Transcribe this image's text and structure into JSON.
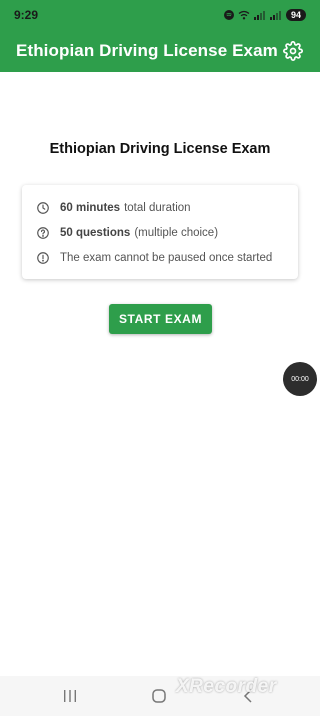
{
  "status_bar": {
    "time": "9:29",
    "battery": "94"
  },
  "app_bar": {
    "title": "Ethiopian Driving License Exam",
    "settings_icon": "gear-icon"
  },
  "main": {
    "heading": "Ethiopian Driving License Exam",
    "info": [
      {
        "icon": "clock-icon",
        "bold": "60 minutes",
        "text": "total duration"
      },
      {
        "icon": "help-circle-icon",
        "bold": "50 questions",
        "text": "(multiple choice)"
      },
      {
        "icon": "alert-circle-icon",
        "bold": "",
        "text": "The exam cannot be paused once started"
      }
    ],
    "start_button": "START EXAM"
  },
  "timer": "00:00",
  "watermark": "XRecorder",
  "colors": {
    "primary": "#2e9e4b",
    "timer_bg": "#2d2d2d"
  }
}
